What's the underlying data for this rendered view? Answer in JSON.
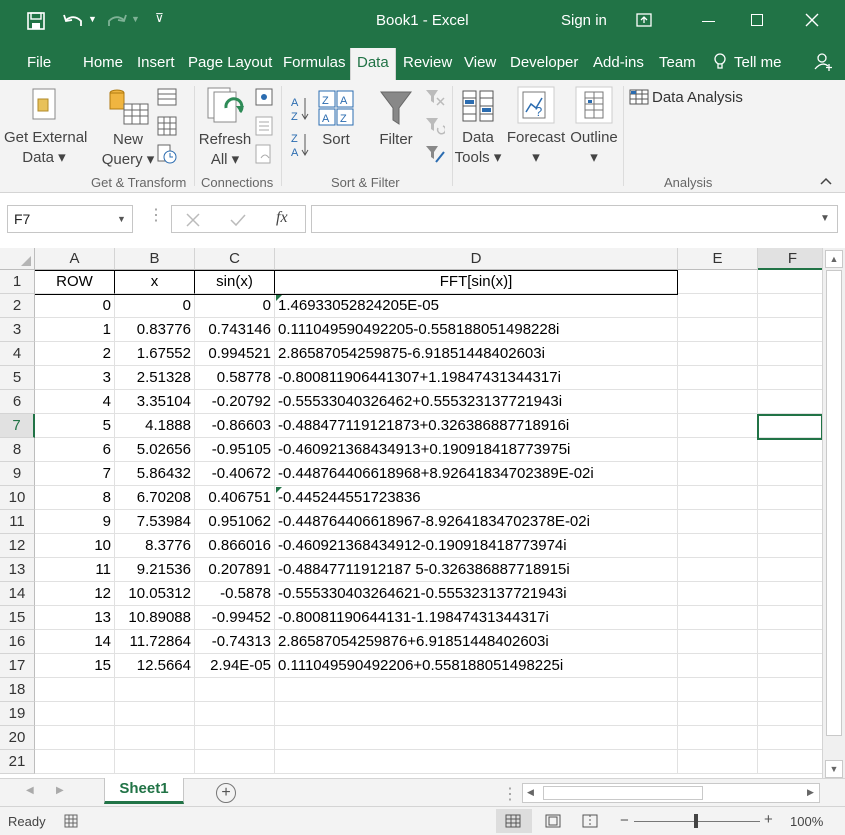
{
  "titlebar": {
    "title": "Book1  -  Excel",
    "sign_in": "Sign in"
  },
  "tabs": [
    "File",
    "Home",
    "Insert",
    "Page Layout",
    "Formulas",
    "Data",
    "Review",
    "View",
    "Developer",
    "Add-ins",
    "Team"
  ],
  "tell_me": "Tell me",
  "ribbon": {
    "get_external": [
      "Get External",
      "Data ▾"
    ],
    "new_query": [
      "New",
      "Query ▾"
    ],
    "refresh_all": [
      "Refresh",
      "All ▾"
    ],
    "sort": "Sort",
    "filter": "Filter",
    "data_tools": [
      "Data",
      "Tools ▾"
    ],
    "forecast": [
      "Forecast",
      "▾"
    ],
    "outline": [
      "Outline",
      "▾"
    ],
    "data_analysis": "Data Analysis",
    "groups": {
      "get_transform": "Get & Transform",
      "connections": "Connections",
      "sort_filter": "Sort & Filter",
      "analysis": "Analysis"
    }
  },
  "formula_bar": {
    "name_box": "F7",
    "fx": "fx",
    "formula": ""
  },
  "columns": [
    "A",
    "B",
    "C",
    "D",
    "E",
    "F"
  ],
  "rows": [
    [
      "ROW",
      "x",
      "sin(x)",
      "FFT[sin(x)]"
    ],
    [
      "0",
      "0",
      "0",
      "1.46933052824205E-05"
    ],
    [
      "1",
      "0.83776",
      "0.743146",
      "0.111049590492205-0.558188051498228i"
    ],
    [
      "2",
      "1.67552",
      "0.994521",
      "2.86587054259875-6.91851448402603i"
    ],
    [
      "3",
      "2.51328",
      "0.58778",
      "-0.800811906441307+1.19847431344317i"
    ],
    [
      "4",
      "3.35104",
      "-0.20792",
      "-0.55533040326462+0.555323137721943i"
    ],
    [
      "5",
      "4.1888",
      "-0.86603",
      "-0.488477119121873+0.326386887718916i"
    ],
    [
      "6",
      "5.02656",
      "-0.95105",
      "-0.460921368434913+0.190918418773975i"
    ],
    [
      "7",
      "5.86432",
      "-0.40672",
      "-0.448764406618968+8.92641834702389E-02i"
    ],
    [
      "8",
      "6.70208",
      "0.406751",
      "-0.445244551723836"
    ],
    [
      "9",
      "7.53984",
      "0.951062",
      "-0.448764406618967-8.92641834702378E-02i"
    ],
    [
      "10",
      "8.3776",
      "0.866016",
      "-0.460921368434912-0.190918418773974i"
    ],
    [
      "11",
      "9.21536",
      "0.207891",
      "-0.48847711912187 5-0.326386887718915i"
    ],
    [
      "12",
      "10.05312",
      "-0.5878",
      "-0.555330403264621-0.555323137721943i"
    ],
    [
      "13",
      "10.89088",
      "-0.99452",
      "-0.80081190644131-1.19847431344317i"
    ],
    [
      "14",
      "11.72864",
      "-0.74313",
      "2.86587054259876+6.91851448402603i"
    ],
    [
      "15",
      "12.5664",
      "2.94E-05",
      "0.111049590492206+0.558188051498225i"
    ]
  ],
  "row_numbers": [
    "1",
    "2",
    "3",
    "4",
    "5",
    "6",
    "7",
    "8",
    "9",
    "10",
    "11",
    "12",
    "13",
    "14",
    "15",
    "16",
    "17",
    "18",
    "19",
    "20",
    "21"
  ],
  "sheet_tab": "Sheet1",
  "status": {
    "ready": "Ready",
    "zoom": "100%"
  },
  "colors": {
    "excel_green": "#217346",
    "ribbon_bg": "#f3f3f3"
  }
}
